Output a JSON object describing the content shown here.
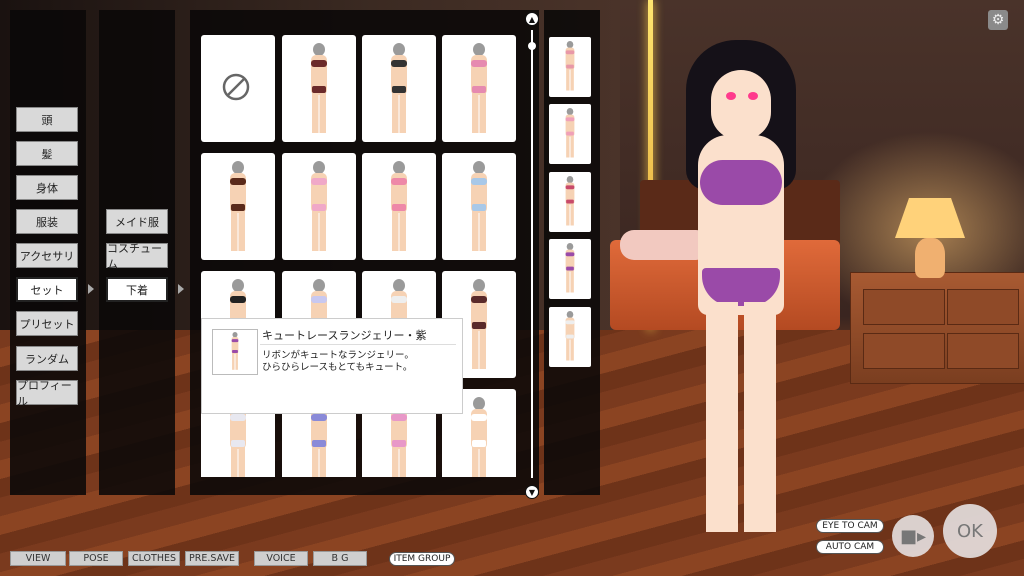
{
  "categories": [
    "頭",
    "髪",
    "身体",
    "服装",
    "アクセサリ",
    "セット",
    "プリセット",
    "ランダム",
    "プロフィール"
  ],
  "selected_category": "セット",
  "subcategories": [
    "メイド服",
    "コスチューム",
    "下着"
  ],
  "selected_subcategory": "下着",
  "items": [
    {
      "kind": "none",
      "icon": "no-entry-icon"
    },
    {
      "kind": "figure",
      "top": "#6b2a2a",
      "bottom": "#6b2a2a"
    },
    {
      "kind": "figure",
      "top": "#333",
      "bottom": "#333"
    },
    {
      "kind": "figure",
      "top": "#e68ab0",
      "bottom": "#e68ab0"
    },
    {
      "kind": "figure",
      "top": "#5a2a1a",
      "bottom": "#5a2a1a"
    },
    {
      "kind": "figure",
      "top": "#f0a8c8",
      "bottom": "#f0a8c8"
    },
    {
      "kind": "figure",
      "top": "#ee88a8",
      "bottom": "#ee88a8"
    },
    {
      "kind": "figure",
      "top": "#a8c8e8",
      "bottom": "#a8c8e8"
    },
    {
      "kind": "figure",
      "top": "#222",
      "bottom": "#222"
    },
    {
      "kind": "figure",
      "top": "#c8c8f0",
      "bottom": "#c8c8f0"
    },
    {
      "kind": "figure",
      "top": "#eee",
      "bottom": "#eee"
    },
    {
      "kind": "figure",
      "top": "#5a2a2a",
      "bottom": "#5a2a2a"
    },
    {
      "kind": "figure",
      "top": "#e8e8f0",
      "bottom": "#e8e8f0"
    },
    {
      "kind": "figure",
      "top": "#8a8ad8",
      "bottom": "#8a8ad8"
    },
    {
      "kind": "figure",
      "top": "#e898c8",
      "bottom": "#e898c8"
    },
    {
      "kind": "figure",
      "top": "#ffffff",
      "bottom": "#ffffff"
    }
  ],
  "history_thumbs": [
    {
      "top": "#e898a8",
      "bottom": "#e898a8"
    },
    {
      "top": "#f0a0b8",
      "bottom": "#f0a0b8"
    },
    {
      "top": "#c84a6a",
      "bottom": "#c84a6a"
    },
    {
      "top": "#9a4aa8",
      "bottom": "#9a4aa8"
    },
    {
      "top": "#eeeeee",
      "bottom": "#eeeeee"
    }
  ],
  "tooltip": {
    "title": "キュートレースランジェリー・紫",
    "description": "リボンがキュートなランジェリー。\nひらひらレースもとてもキュート。",
    "top": "#9a4aa8",
    "bottom": "#9a4aa8"
  },
  "camera": {
    "eye_label": "EYE TO CAM",
    "auto_label": "AUTO CAM"
  },
  "ok_label": "OK",
  "bottom_menu": [
    "VIEW",
    "POSE",
    "CLOTHES",
    "PRE.SAVE",
    "VOICE",
    "B G"
  ],
  "item_group_label": "ITEM GROUP",
  "icons": {
    "settings": "gear-icon",
    "camera": "video-camera-icon",
    "scroll_up": "arrow-up-icon",
    "scroll_down": "arrow-down-icon"
  },
  "colors": {
    "panel": "#0a0808",
    "button": "#d9d9d9",
    "lingerie": "#9a4aa8"
  }
}
